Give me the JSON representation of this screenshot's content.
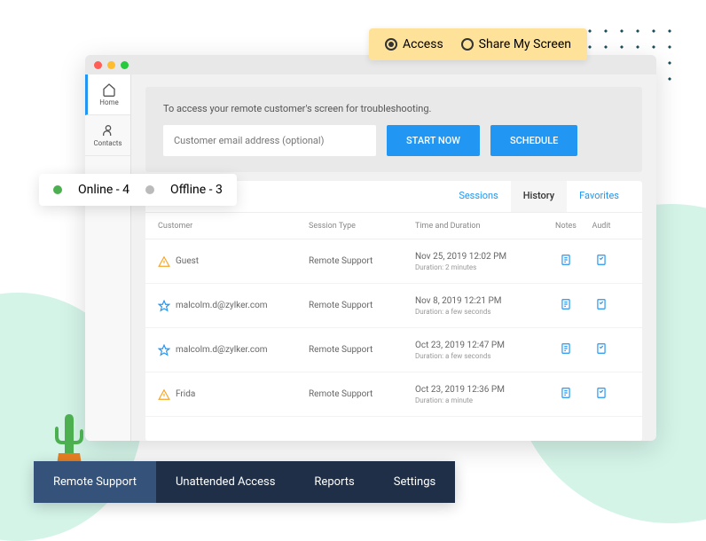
{
  "access_badge": {
    "opt1": "Access",
    "opt2": "Share My Screen"
  },
  "sidebar": {
    "items": [
      {
        "label": "Home"
      },
      {
        "label": "Contacts"
      }
    ]
  },
  "hero": {
    "text": "To access your remote customer's screen for troubleshooting.",
    "placeholder": "Customer email address (optional)",
    "start": "START NOW",
    "schedule": "SCHEDULE"
  },
  "tabs": {
    "sessions": "Sessions",
    "history": "History",
    "favorites": "Favorites"
  },
  "thead": {
    "customer": "Customer",
    "type": "Session Type",
    "time": "Time and Duration",
    "notes": "Notes",
    "audit": "Audit"
  },
  "rows": [
    {
      "icon": "warn",
      "customer": "Guest",
      "type": "Remote Support",
      "time": "Nov 25, 2019 12:02 PM",
      "duration": "Duration: 2 minutes"
    },
    {
      "icon": "star",
      "customer": "malcolm.d@zylker.com",
      "type": "Remote Support",
      "time": "Nov 8, 2019 12:21 PM",
      "duration": "Duration: a few seconds"
    },
    {
      "icon": "star",
      "customer": "malcolm.d@zylker.com",
      "type": "Remote Support",
      "time": "Oct 23, 2019 12:47 PM",
      "duration": "Duration: a few seconds"
    },
    {
      "icon": "warn",
      "customer": "Frida",
      "type": "Remote Support",
      "time": "Oct 23, 2019 12:36 PM",
      "duration": "Duration: a minute"
    }
  ],
  "status": {
    "online": "Online - 4",
    "offline": "Offline - 3"
  },
  "bottom_nav": {
    "remote": "Remote Support",
    "unattended": "Unattended Access",
    "reports": "Reports",
    "settings": "Settings"
  }
}
